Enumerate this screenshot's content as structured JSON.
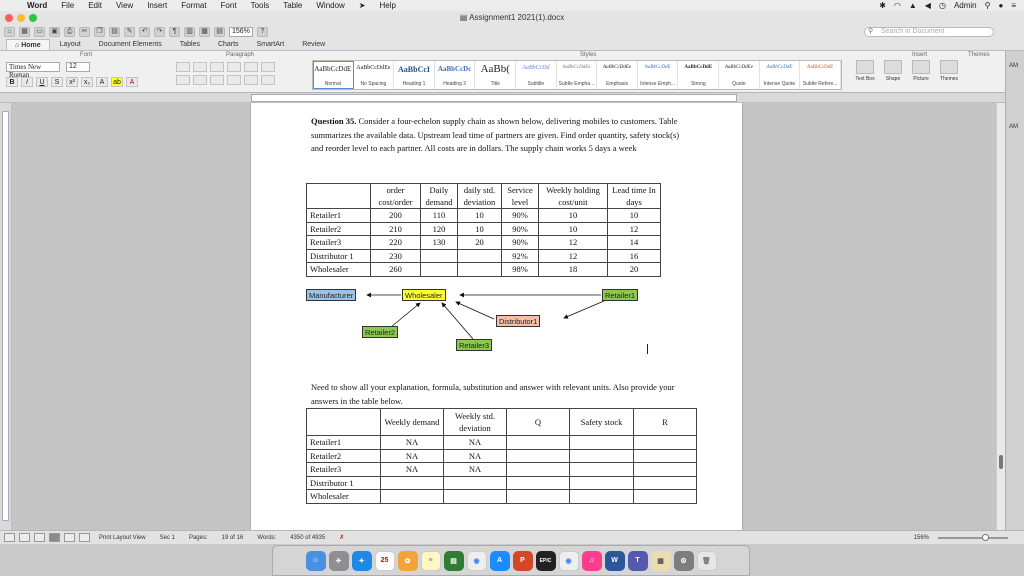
{
  "menubar": {
    "app": "Word",
    "items": [
      "File",
      "Edit",
      "View",
      "Insert",
      "Format",
      "Font",
      "Tools",
      "Table",
      "Window",
      "Help"
    ],
    "user": "Admin"
  },
  "window": {
    "title": "Assignment1 2021(1).docx"
  },
  "toolbar": {
    "zoom": "156%",
    "search_placeholder": "Search in Document"
  },
  "ribbon": {
    "tabs": [
      "Home",
      "Layout",
      "Document Elements",
      "Tables",
      "Charts",
      "SmartArt",
      "Review"
    ],
    "groups": {
      "font": "Font",
      "paragraph": "Paragraph",
      "styles": "Styles",
      "insert": "Insert",
      "themes": "Themes"
    },
    "font_name": "Times New Roman",
    "font_size": "12",
    "styles": [
      {
        "sample": "AaBbCcDdE",
        "name": "Normal"
      },
      {
        "sample": "AaBbCcDdEe",
        "name": "No Spacing"
      },
      {
        "sample": "AaBbCcI",
        "name": "Heading 1"
      },
      {
        "sample": "AaBbCcDc",
        "name": "Heading 2"
      },
      {
        "sample": "AaBb(",
        "name": "Title"
      },
      {
        "sample": "AaBbCcDd",
        "name": "Subtitle"
      },
      {
        "sample": "AaBbCcDdEe",
        "name": "Subtle Empha..."
      },
      {
        "sample": "AaBbCcDdEe",
        "name": "Emphasis"
      },
      {
        "sample": "AaBbCcDdE",
        "name": "Intense Emph..."
      },
      {
        "sample": "AaBbCcDdE",
        "name": "Strong"
      },
      {
        "sample": "AaBbCcDdEe",
        "name": "Quote"
      },
      {
        "sample": "AaBbCcDdE",
        "name": "Intense Quote"
      },
      {
        "sample": "AaBbCcDdE",
        "name": "Subtle Refere..."
      }
    ],
    "insert_buttons": [
      "Text Box",
      "Shape",
      "Picture",
      "Themes"
    ]
  },
  "document": {
    "question_label": "Question 35.",
    "question_text": "Consider a four-echelon supply chain as shown below, delivering mobiles to customers. Table summarizes the available data. Upstream lead time of partners are given. Find order quantity, safety stock(s) and reorder level to each partner. All costs are in dollars. The supply chain works 5 days a week",
    "table1": {
      "headers": [
        "",
        "order cost/order",
        "Daily demand",
        "daily std. deviation",
        "Service level",
        "Weekly holding cost/unit",
        "Lead time In days"
      ],
      "rows": [
        [
          "Retailer1",
          "200",
          "110",
          "10",
          "90%",
          "10",
          "10"
        ],
        [
          "Retailer2",
          "210",
          "120",
          "10",
          "90%",
          "10",
          "12"
        ],
        [
          "Retailer3",
          "220",
          "130",
          "20",
          "90%",
          "12",
          "14"
        ],
        [
          "Distributor 1",
          "230",
          "",
          "",
          "92%",
          "12",
          "16"
        ],
        [
          "Wholesaler",
          "260",
          "",
          "",
          "98%",
          "18",
          "20"
        ]
      ]
    },
    "diagram": {
      "manufacturer": "Manufacturer",
      "wholesaler": "Wholesaler",
      "retailer1": "Retailer1",
      "retailer2": "Retailer2",
      "retailer3": "Retailer3",
      "distributor1": "Distributor1"
    },
    "instructions": "Need to show all your explanation, formula, substitution and answer with relevant units. Also provide your answers in the table below.",
    "table2": {
      "headers": [
        "",
        "Weekly demand",
        "Weekly std. deviation",
        "Q",
        "Safety stock",
        "R"
      ],
      "rows": [
        [
          "Retailer1",
          "NA",
          "NA",
          "",
          "",
          ""
        ],
        [
          "Retailer2",
          "NA",
          "NA",
          "",
          "",
          ""
        ],
        [
          "Retailer3",
          "NA",
          "NA",
          "",
          "",
          ""
        ],
        [
          "Distributor 1",
          "",
          "",
          "",
          "",
          ""
        ],
        [
          "Wholesaler",
          "",
          "",
          "",
          "",
          ""
        ]
      ]
    }
  },
  "status": {
    "view": "Print Layout View",
    "sec": "Sec  1",
    "pages_label": "Pages:",
    "pages": "19 of 16",
    "words_label": "Words:",
    "words": "4350 of 4935",
    "zoom": "156%"
  },
  "sidepane": {
    "top": "AM",
    "bottom": "AM"
  },
  "colors": {
    "manufacturer": "#99c3e8",
    "wholesaler": "#ffff33",
    "retailer": "#8cc850",
    "distributor": "#f4c0a8"
  },
  "dock": [
    "finder",
    "launchpad",
    "safari",
    "calendar",
    "photos",
    "notes",
    "reminders",
    "chrome",
    "app-store",
    "powerpoint",
    "epic-games",
    "chrome-2",
    "itunes",
    "word",
    "teams",
    "preview",
    "system-preferences",
    "trash"
  ]
}
